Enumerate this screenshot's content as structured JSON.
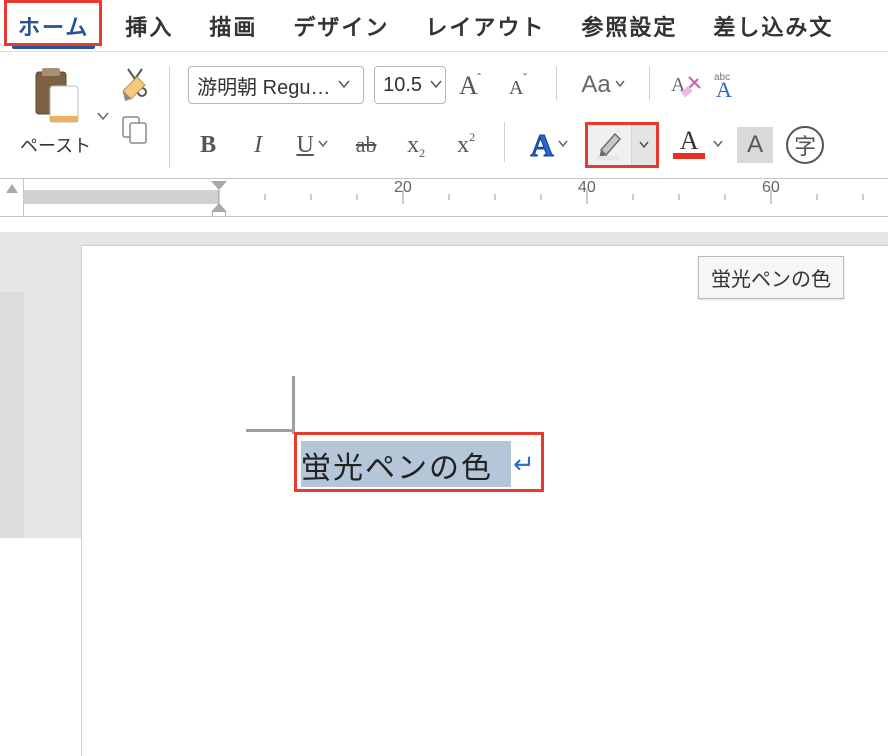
{
  "tabs": {
    "home": "ホーム",
    "insert": "挿入",
    "draw": "描画",
    "design": "デザイン",
    "layout": "レイアウト",
    "references": "参照設定",
    "mailings": "差し込み文"
  },
  "clipboard": {
    "paste_label": "ペースト"
  },
  "font": {
    "name": "游明朝 Regu…",
    "size": "10.5",
    "case_label": "Aa",
    "bold": "B",
    "italic": "I",
    "underline": "U",
    "strike": "ab",
    "subscript_base": "x",
    "subscript_idx": "2",
    "superscript_base": "x",
    "superscript_idx": "2",
    "effect": "A",
    "font_color_a": "A",
    "shade": "A",
    "enclose": "字"
  },
  "tooltip": {
    "highlight": "蛍光ペンの色"
  },
  "ruler": {
    "n20": "20",
    "n40": "40",
    "n60": "60"
  },
  "document": {
    "selected_text": "蛍光ペンの色",
    "para_mark": "↵"
  }
}
